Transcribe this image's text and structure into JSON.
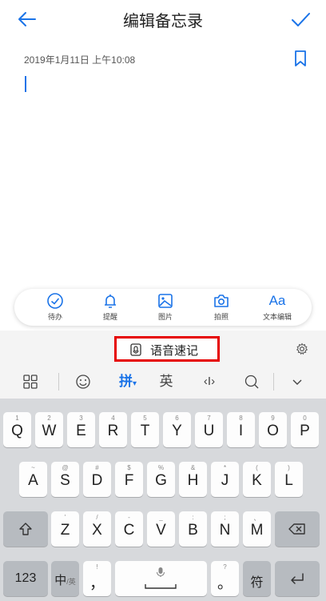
{
  "header": {
    "title": "编辑备忘录"
  },
  "note": {
    "timestamp": "2019年1月11日 上午10:08"
  },
  "toolbar": {
    "items": [
      {
        "label": "待办"
      },
      {
        "label": "提醒"
      },
      {
        "label": "图片"
      },
      {
        "label": "拍照"
      },
      {
        "label": "文本编辑",
        "glyph": "Aa"
      }
    ]
  },
  "voice_note": {
    "label": "语音速记"
  },
  "keyboard_top": {
    "pinyin": "拼",
    "english": "英",
    "cursor": "‹I›"
  },
  "keyboard": {
    "row1": [
      {
        "sub": "1",
        "main": "Q"
      },
      {
        "sub": "2",
        "main": "W"
      },
      {
        "sub": "3",
        "main": "E"
      },
      {
        "sub": "4",
        "main": "R"
      },
      {
        "sub": "5",
        "main": "T"
      },
      {
        "sub": "6",
        "main": "Y"
      },
      {
        "sub": "7",
        "main": "U"
      },
      {
        "sub": "8",
        "main": "I"
      },
      {
        "sub": "9",
        "main": "O"
      },
      {
        "sub": "0",
        "main": "P"
      }
    ],
    "row2": [
      {
        "sub": "~",
        "main": "A"
      },
      {
        "sub": "@",
        "main": "S"
      },
      {
        "sub": "#",
        "main": "D"
      },
      {
        "sub": "$",
        "main": "F"
      },
      {
        "sub": "%",
        "main": "G"
      },
      {
        "sub": "&",
        "main": "H"
      },
      {
        "sub": "*",
        "main": "J"
      },
      {
        "sub": "(",
        "main": "K"
      },
      {
        "sub": ")",
        "main": "L"
      }
    ],
    "row3": [
      {
        "sub": "'",
        "main": "Z"
      },
      {
        "sub": "/",
        "main": "X"
      },
      {
        "sub": "-",
        "main": "C"
      },
      {
        "sub": "_",
        "main": "V"
      },
      {
        "sub": ":",
        "main": "B"
      },
      {
        "sub": ";",
        "main": "N"
      },
      {
        "sub": "、",
        "main": "M"
      }
    ],
    "numbers_label": "123",
    "lang_label": "中",
    "lang_sub": "/英",
    "comma_sub": "!",
    "comma": "，",
    "period_sub": "?",
    "period": "。",
    "symbols_label": "符"
  },
  "colors": {
    "accent": "#1a73e8",
    "highlight_border": "#e60000"
  }
}
